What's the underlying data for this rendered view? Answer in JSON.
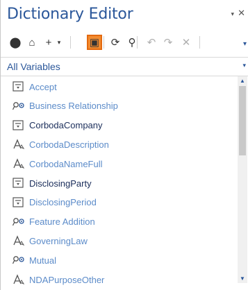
{
  "pane": {
    "title": "Dictionary Editor",
    "pin_glyph": "▾",
    "close_glyph": "✕"
  },
  "toolbar": {
    "buttons": [
      {
        "name": "go-back-icon",
        "glyph": "⬤",
        "disabled": false
      },
      {
        "name": "home-icon",
        "glyph": "⌂",
        "disabled": false
      },
      {
        "name": "add-icon",
        "glyph": "+",
        "disabled": false
      },
      {
        "name": "add-dropdown-icon",
        "glyph": "▾",
        "disabled": false
      },
      {
        "name": "panel-toggle-icon",
        "glyph": "▣",
        "disabled": false,
        "active": true
      },
      {
        "name": "refresh-icon",
        "glyph": "⟳",
        "disabled": false
      },
      {
        "name": "search-icon",
        "glyph": "⚲",
        "disabled": false
      },
      {
        "name": "undo-icon",
        "glyph": "↶",
        "disabled": true
      },
      {
        "name": "redo-icon",
        "glyph": "↷",
        "disabled": true
      },
      {
        "name": "delete-icon",
        "glyph": "✕",
        "disabled": true
      }
    ],
    "overflow_glyph": "▾"
  },
  "filter": {
    "selected": "All Variables",
    "arrow_glyph": "▾"
  },
  "variables": [
    {
      "label": "Accept",
      "icon": "choice-variable-icon",
      "dark": false
    },
    {
      "label": "Business Relationship",
      "icon": "multi-select-variable-icon",
      "dark": false
    },
    {
      "label": "CorbodaCompany",
      "icon": "choice-variable-icon",
      "dark": true
    },
    {
      "label": "CorbodaDescription",
      "icon": "text-variable-icon",
      "dark": false
    },
    {
      "label": "CorbodaNameFull",
      "icon": "text-variable-icon",
      "dark": false
    },
    {
      "label": "DisclosingParty",
      "icon": "choice-variable-icon",
      "dark": true
    },
    {
      "label": "DisclosingPeriod",
      "icon": "choice-variable-icon",
      "dark": false
    },
    {
      "label": "Feature Addition",
      "icon": "multi-select-variable-icon",
      "dark": false
    },
    {
      "label": "GoverningLaw",
      "icon": "text-variable-icon",
      "dark": false
    },
    {
      "label": "Mutual",
      "icon": "multi-select-variable-icon",
      "dark": false
    },
    {
      "label": "NDAPurposeOther",
      "icon": "text-variable-icon",
      "dark": false
    }
  ],
  "scrollbar": {
    "up_glyph": "▲",
    "down_glyph": "▼"
  },
  "colors": {
    "accent": "#2b579a",
    "active_button": "#f28b30",
    "item_text": "#5b8bc9",
    "item_text_dark": "#1a2d5a"
  }
}
